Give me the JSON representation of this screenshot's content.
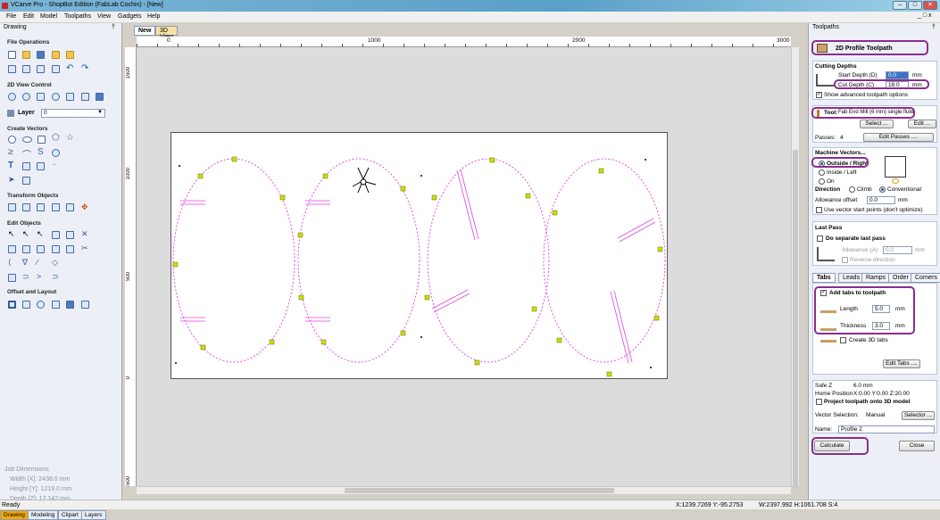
{
  "window": {
    "title": "VCarve Pro - ShopBot Edition (FabLab Cochin) - [New]"
  },
  "menu": [
    "File",
    "Edit",
    "Model",
    "Toolpaths",
    "View",
    "Gadgets",
    "Help"
  ],
  "left": {
    "panel_title": "Drawing",
    "sections": {
      "file_ops": "File Operations",
      "view_ctrl": "2D View Control",
      "create_vectors": "Create Vectors",
      "transform": "Transform Objects",
      "edit": "Edit Objects",
      "offset": "Offset and Layout"
    },
    "layer_label": "Layer",
    "layer_value": "0",
    "job": {
      "title": "Job Dimensions",
      "width": "Width  [X]: 2438.0 mm",
      "height": "Height [Y]: 1219.0 mm",
      "depth": "Depth  [Z]: 17.142 mm"
    },
    "bottom_tabs": [
      "Drawing",
      "Modeling",
      "Clipart",
      "Layers"
    ]
  },
  "doc_tabs": [
    "New",
    "3D View"
  ],
  "rulers": {
    "top": [
      "0",
      "1000",
      "2000",
      "3000"
    ],
    "left": [
      "1500",
      "1000",
      "500",
      "0",
      "-500"
    ]
  },
  "right": {
    "panel_title": "Toolpaths",
    "header": "2D Profile Toolpath",
    "cutting_depths": "Cutting Depths",
    "start_depth_label": "Start Depth (D)",
    "start_depth": "0.0",
    "cut_depth_label": "Cut Depth (C)",
    "cut_depth": "18.0",
    "unit": "mm",
    "show_adv": "Show advanced toolpath options",
    "tool_label": "Tool:",
    "tool_name": "Fab End Mill (6 mm) single flute",
    "select_btn": "Select ...",
    "edit_btn": "Edit ...",
    "passes_label": "Passes:",
    "passes": "4",
    "edit_passes_btn": "Edit Passes ....",
    "machine_vectors": "Machine Vectors...",
    "outside": "Outside / Right",
    "inside": "Inside / Left",
    "on": "On",
    "direction_label": "Direction",
    "climb": "Climb",
    "conventional": "Conventional",
    "allowance_label": "Allowance offset",
    "allowance": "0.0",
    "use_start": "Use vector start points (don't optimize)",
    "last_pass": "Last Pass",
    "do_separate": "Do separate last pass",
    "allowance_a_label": "Allowance (A)",
    "allowance_a": "0.0",
    "reverse": "Reverse direction",
    "tabs": [
      "Tabs",
      "Leads",
      "Ramps",
      "Order",
      "Corners"
    ],
    "add_tabs": "Add tabs to toolpath",
    "length_label": "Length",
    "length": "5.0",
    "thickness_label": "Thickness",
    "thickness": "3.0",
    "create_3d": "Create 3D tabs",
    "edit_tabs_btn": "Edit Tabs ....",
    "safe_z_label": "Safe Z",
    "safe_z": "6.0 mm",
    "home_label": "Home Position",
    "home": "X:0.00 Y:0.00 Z:20.00",
    "project": "Project toolpath onto 3D model",
    "vector_sel_label": "Vector Selection:",
    "vector_sel": "Manual",
    "selector_btn": "Selector ...",
    "name_label": "Name:",
    "name": "Profile 2",
    "calculate_btn": "Calculate",
    "close_btn": "Close"
  },
  "status": {
    "left": "Ready",
    "coords": "X:1239.7269 Y:-95.2753",
    "dims": "W:2397.992  H:1061.708  S:4"
  },
  "colors": {
    "toolpath": "#e040e0",
    "highlight": "#8b2c8f",
    "tab_marker": "#c8e000"
  }
}
